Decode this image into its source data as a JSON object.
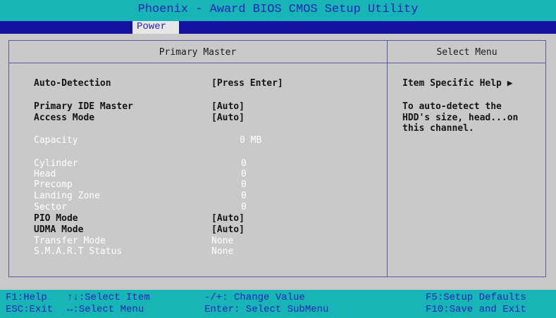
{
  "title_bar": {
    "title": "Phoenix - Award BIOS CMOS Setup Utility"
  },
  "menu": {
    "active_tab": "Power"
  },
  "main_panel": {
    "header": "Primary Master"
  },
  "help_panel": {
    "header": "Select Menu",
    "item_specific_help": "Item Specific Help ▶",
    "description_lines": [
      "To auto-detect the",
      "HDD's size, head...on",
      "this channel."
    ]
  },
  "settings": {
    "auto_detection": {
      "label": "Auto-Detection",
      "value": "[Press Enter]"
    },
    "primary_ide_master": {
      "label": "Primary IDE Master",
      "value": "[Auto]"
    },
    "access_mode": {
      "label": "Access Mode",
      "value": "[Auto]"
    },
    "capacity": {
      "label": "Capacity",
      "value": "0 MB"
    },
    "cylinder": {
      "label": "Cylinder",
      "value": "0"
    },
    "head": {
      "label": "Head",
      "value": "0"
    },
    "precomp": {
      "label": "Precomp",
      "value": "0"
    },
    "landing_zone": {
      "label": "Landing Zone",
      "value": "0"
    },
    "sector": {
      "label": "Sector",
      "value": "0"
    },
    "pio_mode": {
      "label": "PIO Mode",
      "value": "[Auto]"
    },
    "udma_mode": {
      "label": "UDMA Mode",
      "value": "[Auto]"
    },
    "transfer_mode": {
      "label": "Transfer Mode",
      "value": "None"
    },
    "smart_status": {
      "label": "S.M.A.R.T Status",
      "value": "None"
    }
  },
  "footer": {
    "f1": "F1:Help",
    "esc": "ESC:Exit",
    "select_item": "↑↓:Select Item",
    "select_menu": "↔:Select Menu",
    "change_value": "-/+: Change Value",
    "enter": "Enter: Select SubMenu",
    "f5": "F5:Setup Defaults",
    "f10": "F10:Save and Exit"
  },
  "colors": {
    "title_bg": "#17b5b5",
    "menubar_bg": "#1414a0",
    "panel_bg": "#c9c9c9",
    "accent_text": "#2424b8"
  }
}
